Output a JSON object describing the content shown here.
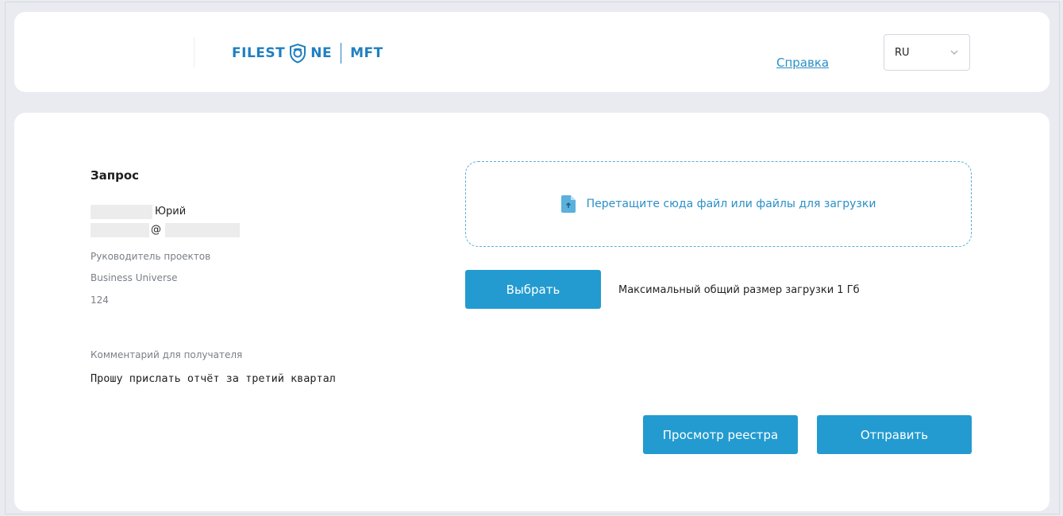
{
  "header": {
    "logo": {
      "word1": "FILEST",
      "word2": "NE",
      "product": "MFT"
    },
    "help_link": "Справка",
    "language": {
      "selected": "RU"
    }
  },
  "request": {
    "title": "Запрос",
    "name_visible": "Юрий",
    "email_visible": "@",
    "position": "Руководитель проектов",
    "company": "Business Universe",
    "number": "124",
    "comment_label": "Комментарий для получателя",
    "comment": "Прошу прислать отчёт за третий квартал"
  },
  "upload": {
    "dropzone_text": "Перетащите сюда файл или файлы для загрузки",
    "select_button": "Выбрать",
    "size_note": "Максимальный общий размер загрузки 1 Гб"
  },
  "actions": {
    "registry_button": "Просмотр реестра",
    "send_button": "Отправить"
  },
  "colors": {
    "accent": "#239bd0",
    "link": "#2a8fc6",
    "logo": "#1f7fc1",
    "background": "#e9ebf1"
  },
  "icons": [
    "shield-logo-icon",
    "chevron-down-icon",
    "file-upload-icon"
  ]
}
